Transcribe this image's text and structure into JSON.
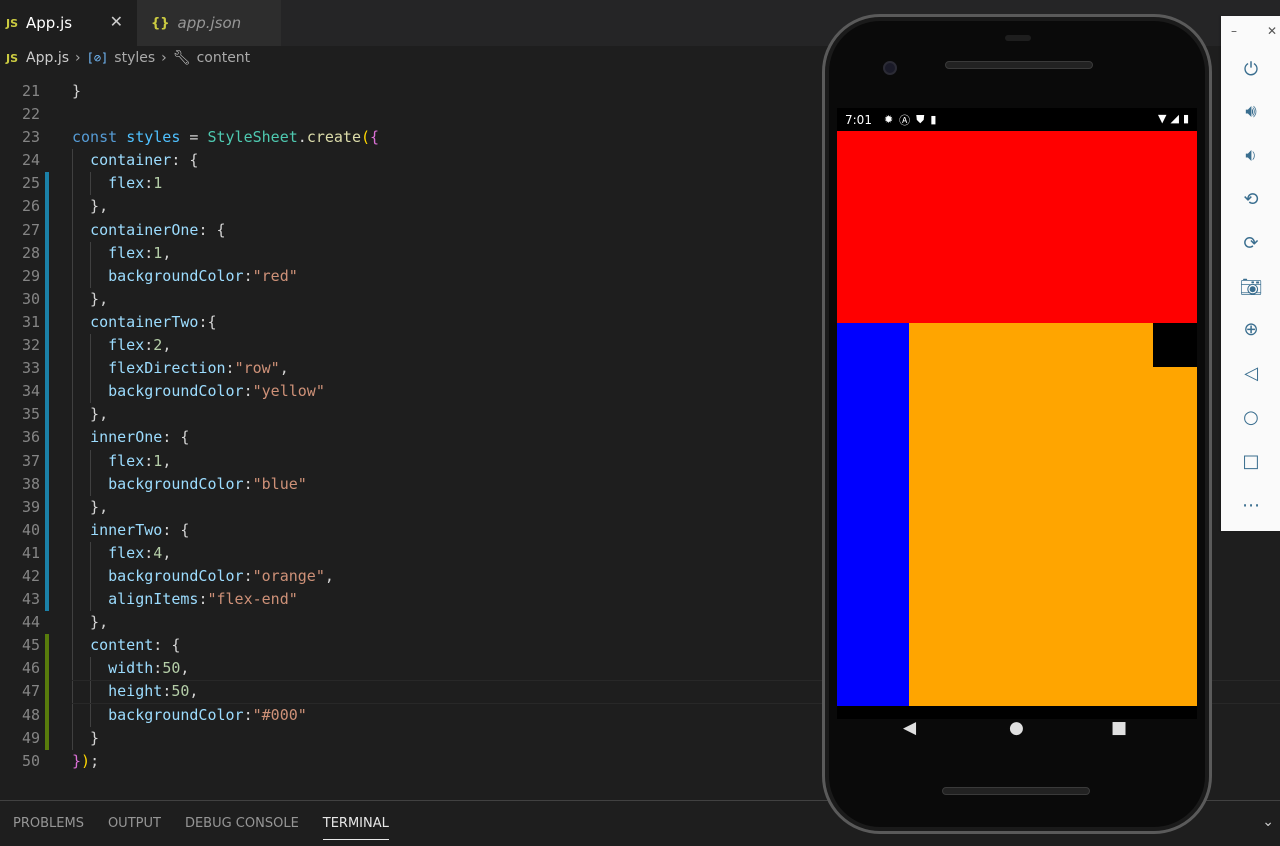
{
  "editor": {
    "tabs": [
      {
        "label": "App.js",
        "badge": "JS",
        "active": true
      },
      {
        "label": "app.json",
        "badge": "{}",
        "active": false
      }
    ],
    "breadcrumb": {
      "file": "App.js",
      "symbol": "styles",
      "property": "content"
    },
    "close_symbol": "✕"
  },
  "code_lines": [
    {
      "n": "21",
      "text": "}"
    },
    {
      "n": "22",
      "text": ""
    },
    {
      "n": "23",
      "text": "const styles = StyleSheet.create({"
    },
    {
      "n": "24",
      "text": "  container: {"
    },
    {
      "n": "25",
      "text": "    flex:1"
    },
    {
      "n": "26",
      "text": "  },"
    },
    {
      "n": "27",
      "text": "  containerOne: {"
    },
    {
      "n": "28",
      "text": "    flex:1,"
    },
    {
      "n": "29",
      "text": "    backgroundColor:\"red\""
    },
    {
      "n": "30",
      "text": "  },"
    },
    {
      "n": "31",
      "text": "  containerTwo:{"
    },
    {
      "n": "32",
      "text": "    flex:2,"
    },
    {
      "n": "33",
      "text": "    flexDirection:\"row\","
    },
    {
      "n": "34",
      "text": "    backgroundColor:\"yellow\""
    },
    {
      "n": "35",
      "text": "  },"
    },
    {
      "n": "36",
      "text": "  innerOne: {"
    },
    {
      "n": "37",
      "text": "    flex:1,"
    },
    {
      "n": "38",
      "text": "    backgroundColor:\"blue\""
    },
    {
      "n": "39",
      "text": "  },"
    },
    {
      "n": "40",
      "text": "  innerTwo: {"
    },
    {
      "n": "41",
      "text": "    flex:4,"
    },
    {
      "n": "42",
      "text": "    backgroundColor:\"orange\","
    },
    {
      "n": "43",
      "text": "    alignItems:\"flex-end\""
    },
    {
      "n": "44",
      "text": "  },"
    },
    {
      "n": "45",
      "text": "  content: {"
    },
    {
      "n": "46",
      "text": "    width:50,"
    },
    {
      "n": "47",
      "text": "    height:50,"
    },
    {
      "n": "48",
      "text": "    backgroundColor:\"#000\""
    },
    {
      "n": "49",
      "text": "  }"
    },
    {
      "n": "50",
      "text": "});"
    }
  ],
  "panel": {
    "tabs": [
      "PROBLEMS",
      "OUTPUT",
      "DEBUG CONSOLE",
      "TERMINAL"
    ],
    "active_tab": "TERMINAL"
  },
  "phone": {
    "status_time": "7:01",
    "colors": {
      "container_one": "#ff0000",
      "inner_one": "#0000ff",
      "inner_two": "#ffa500",
      "content": "#000000"
    }
  },
  "emulator_toolbar": {
    "buttons": [
      "power-icon",
      "volume-up-icon",
      "volume-down-icon",
      "rotate-left-icon",
      "rotate-right-icon",
      "camera-icon",
      "zoom-icon",
      "back-icon",
      "home-icon",
      "overview-icon",
      "more-icon"
    ]
  }
}
